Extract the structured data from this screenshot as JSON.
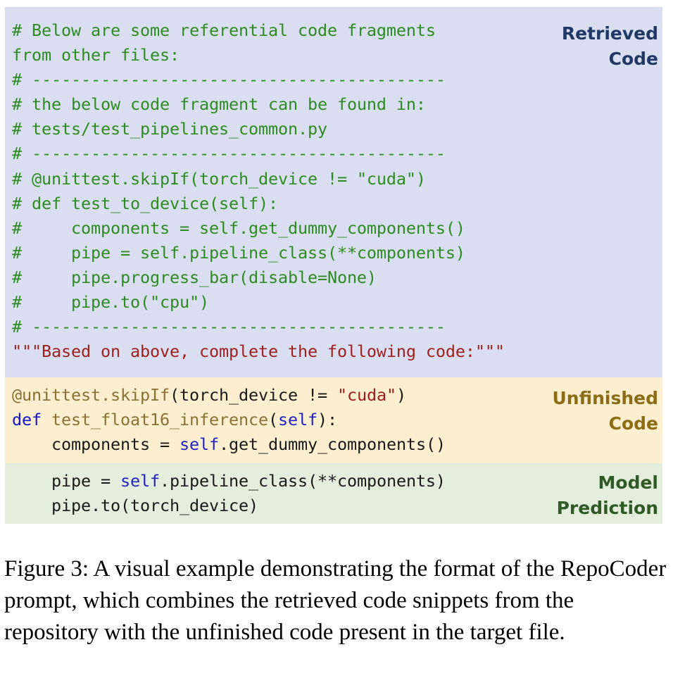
{
  "figure": {
    "caption": "Figure 3: A visual example demonstrating the format of the RepoCoder prompt, which combines the retrieved code snippets from the repository with the unfinished code present in the target file.",
    "colors": {
      "retrieved_bg": "#dadef1",
      "retrieved_label": "#1f3864",
      "retrieved_code": "#2e8b22",
      "unfinished_bg": "#fcefd0",
      "unfinished_label": "#8a6d14",
      "prediction_bg": "#e4eedc",
      "prediction_label": "#2f5a25",
      "string": "#a01f1f",
      "keyword": "#1414d2",
      "decorator": "#8a7035",
      "self": "#2222c4",
      "plain": "#1a1a1a"
    }
  },
  "panels": {
    "retrieved": {
      "label": "Retrieved\nCode",
      "lines": [
        "# Below are some referential code fragments",
        "from other files:",
        "# ------------------------------------------",
        "# the below code fragment can be found in:",
        "# tests/test_pipelines_common.py",
        "# ------------------------------------------",
        "# @unittest.skipIf(torch_device != \"cuda\")",
        "# def test_to_device(self):",
        "#     components = self.get_dummy_components()",
        "#     pipe = self.pipeline_class(**components)",
        "#     pipe.progress_bar(disable=None)",
        "#     pipe.to(\"cpu\")",
        "# ------------------------------------------"
      ],
      "docstring_line": "\"\"\"Based on above, complete the following code:\"\"\""
    },
    "unfinished": {
      "label": "Unfinished\nCode",
      "line1_decorator": "@unittest.skipIf",
      "line1_open": "(torch_device != ",
      "line1_string": "\"cuda\"",
      "line1_close": ")",
      "line2_keyword": "def",
      "line2_funcname": " test_float16_inference",
      "line2_paren_open": "(",
      "line2_self": "self",
      "line2_paren_close": "):",
      "line3_indent": "    components = ",
      "line3_self": "self",
      "line3_rest": ".get_dummy_components()"
    },
    "prediction": {
      "label": "Model\nPrediction",
      "line1_indent": "    pipe = ",
      "line1_self": "self",
      "line1_rest": ".pipeline_class(**components)",
      "line2": "    pipe.to(torch_device)"
    }
  }
}
